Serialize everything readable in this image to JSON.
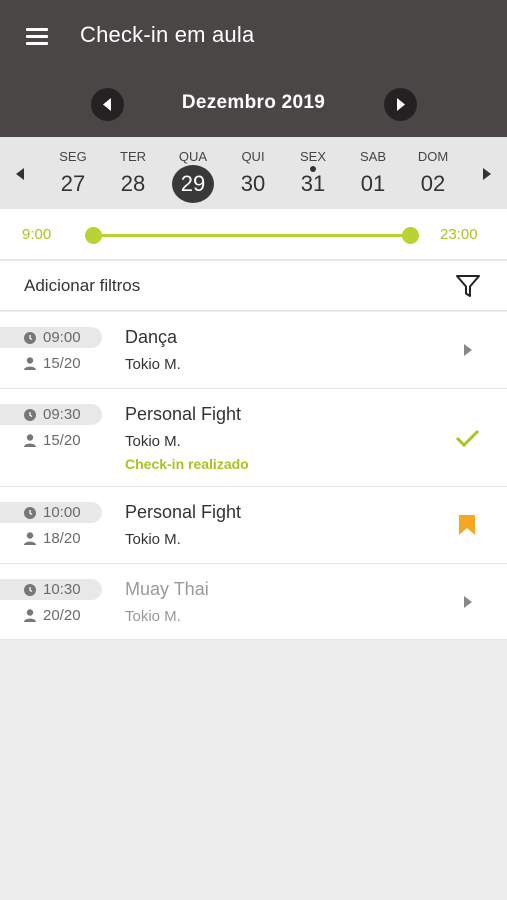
{
  "header": {
    "title": "Check-in em aula",
    "month": "Dezembro 2019"
  },
  "days": [
    {
      "name": "SEG",
      "num": "27"
    },
    {
      "name": "TER",
      "num": "28"
    },
    {
      "name": "QUA",
      "num": "29"
    },
    {
      "name": "QUI",
      "num": "30"
    },
    {
      "name": "SEX",
      "num": "31"
    },
    {
      "name": "SAB",
      "num": "01"
    },
    {
      "name": "DOM",
      "num": "02"
    }
  ],
  "selected_day": "29",
  "marked_day": "31",
  "time_filter": {
    "start": "9:00",
    "end": "23:00"
  },
  "filters": {
    "label": "Adicionar filtros"
  },
  "classes": [
    {
      "time": "09:00",
      "capacity": "15/20",
      "name": "Dança",
      "instructor": "Tokio M.",
      "status": "",
      "action": "chevron-right-icon"
    },
    {
      "time": "09:30",
      "capacity": "15/20",
      "name": "Personal Fight",
      "instructor": "Tokio M.",
      "status": "Check-in realizado",
      "action": "checkmark-icon"
    },
    {
      "time": "10:00",
      "capacity": "18/20",
      "name": "Personal Fight",
      "instructor": "Tokio M.",
      "status": "",
      "action": "bookmark-icon"
    },
    {
      "time": "10:30",
      "capacity": "20/20",
      "name": "Muay Thai",
      "instructor": "Tokio M.",
      "status": "",
      "action": "chevron-right-icon"
    }
  ],
  "colors": {
    "header_bg": "#4a4646",
    "accent_green": "#a5c521",
    "bookmark_orange": "#f5a623",
    "selected_day_bg": "#3a3838"
  }
}
